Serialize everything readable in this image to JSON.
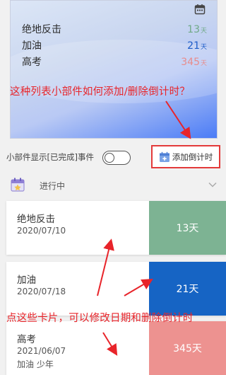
{
  "widget": {
    "rows": [
      {
        "name": "绝地反击",
        "num": "13",
        "unit": "天",
        "color": "#6fa987"
      },
      {
        "name": "加油",
        "num": "21",
        "unit": "天",
        "color": "#1d5cc8"
      },
      {
        "name": "高考",
        "num": "345",
        "unit": "天",
        "color": "#e88c8c"
      }
    ]
  },
  "annotations": {
    "top": "这种列表小部件如何添加/删除倒计时？",
    "bottom": "点这些卡片，可以修改日期和删除倒计时"
  },
  "toolbar": {
    "toggle_label": "小部件显示[已完成]事件",
    "add_label": "添加倒计时"
  },
  "section": {
    "title": "进行中"
  },
  "cards": [
    {
      "name": "绝地反击",
      "date": "2020/07/10",
      "extra": "",
      "days": "13天",
      "color": "#7db393"
    },
    {
      "name": "加油",
      "date": "2020/07/18",
      "extra": "",
      "days": "21天",
      "color": "#1664c4"
    },
    {
      "name": "高考",
      "date": "2021/06/07",
      "extra": "加油 少年",
      "days": "345天",
      "color": "#ed9290"
    }
  ],
  "icons": [
    "calendar-icon",
    "toggle-switch",
    "add-calendar-icon",
    "section-calendar-icon",
    "chevron-down-icon"
  ]
}
